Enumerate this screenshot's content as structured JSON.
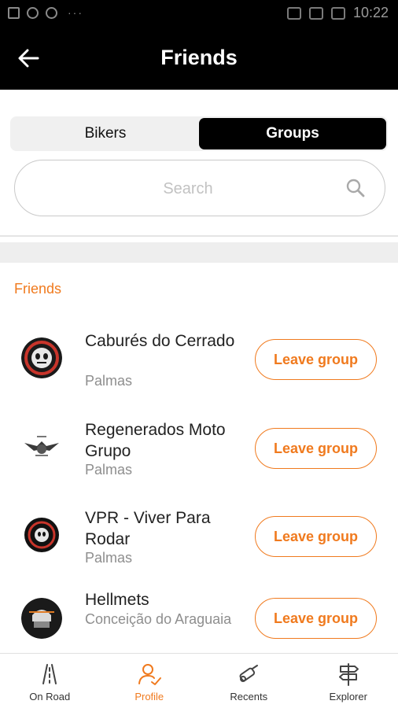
{
  "status_bar": {
    "time": "10:22"
  },
  "app_bar": {
    "title": "Friends",
    "back_icon": "arrow-left-icon"
  },
  "segments": {
    "bikers": "Bikers",
    "groups": "Groups",
    "selected": "groups"
  },
  "search": {
    "placeholder": "Search",
    "icon": "search-icon"
  },
  "section": {
    "label": "Friends"
  },
  "groups": [
    {
      "name": "Caburés do Cerrado",
      "city": "Palmas",
      "action": "Leave group"
    },
    {
      "name": "Regenerados Moto Grupo",
      "city": "Palmas",
      "action": "Leave group"
    },
    {
      "name": "VPR - Viver Para Rodar",
      "city": "Palmas",
      "action": "Leave group"
    },
    {
      "name": "Hellmets",
      "city": "Conceição do Araguaia",
      "action": "Leave group"
    }
  ],
  "bottom_nav": [
    {
      "label": "On Road",
      "icon": "road-icon",
      "active": false
    },
    {
      "label": "Profile",
      "icon": "profile-icon",
      "active": true
    },
    {
      "label": "Recents",
      "icon": "recents-icon",
      "active": false
    },
    {
      "label": "Explorer",
      "icon": "signpost-icon",
      "active": false
    }
  ],
  "colors": {
    "accent": "#f07a1e",
    "app_bar": "#000000",
    "segment_selected": "#000000"
  }
}
